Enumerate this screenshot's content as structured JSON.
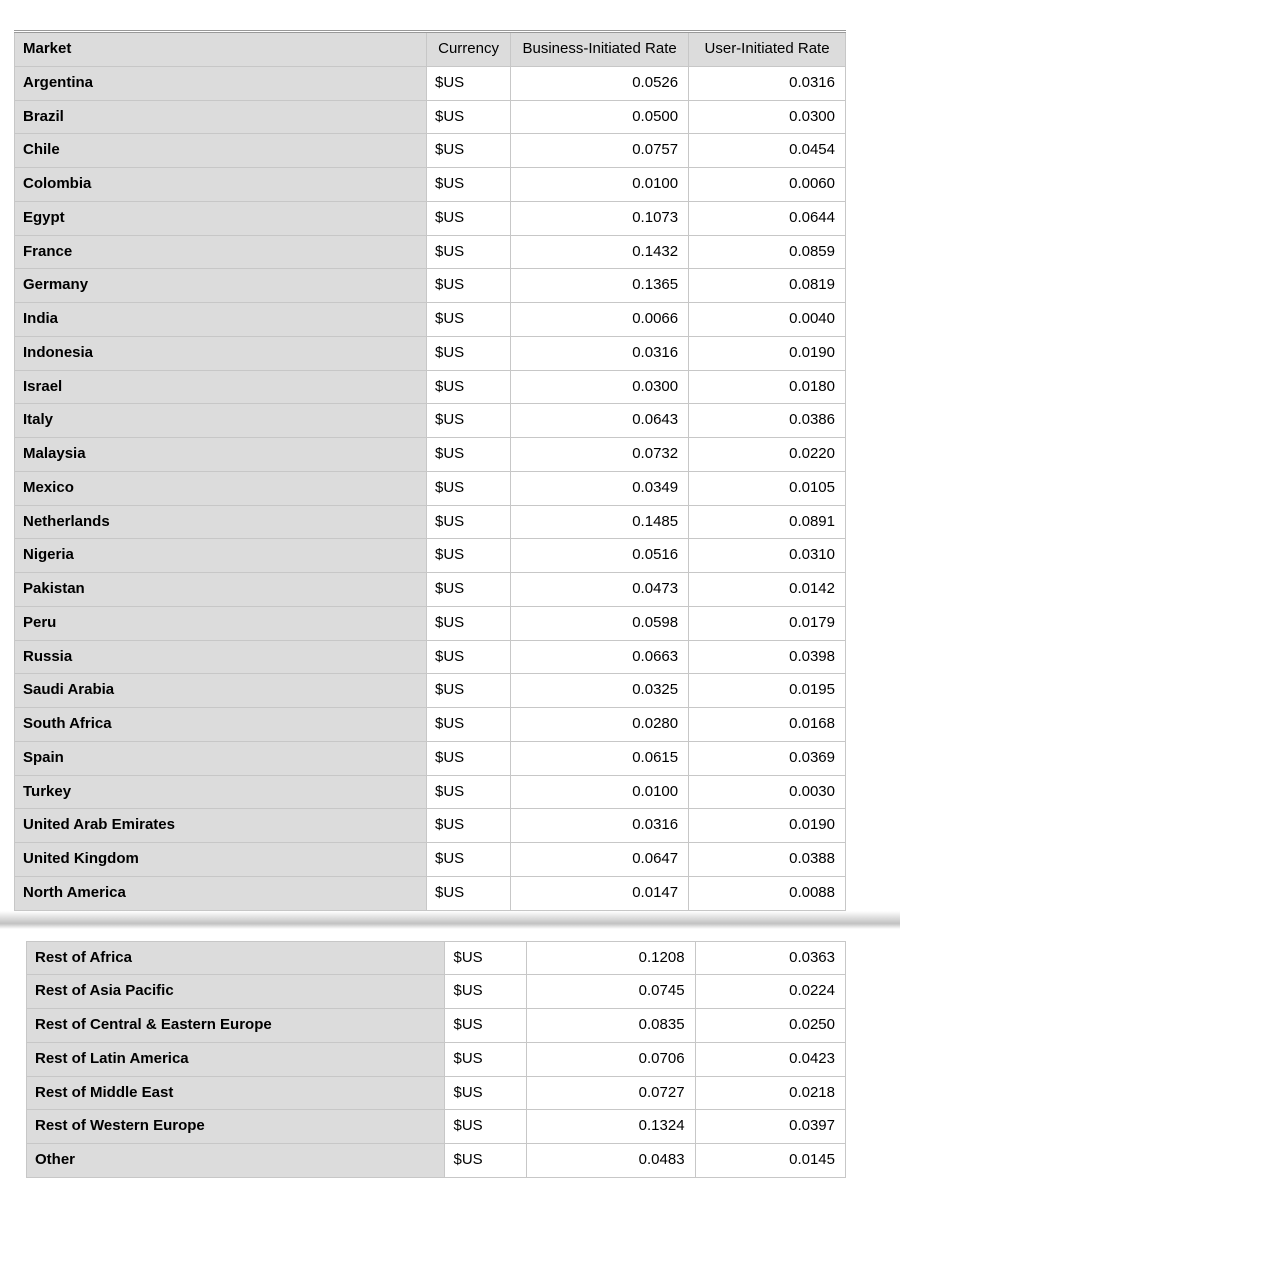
{
  "columns": {
    "market": "Market",
    "currency": "Currency",
    "biz": "Business-Initiated Rate",
    "user": "User-Initiated Rate"
  },
  "currency_label": "$US",
  "rows1": [
    {
      "market": "Argentina",
      "biz": "0.0526",
      "user": "0.0316"
    },
    {
      "market": "Brazil",
      "biz": "0.0500",
      "user": "0.0300"
    },
    {
      "market": "Chile",
      "biz": "0.0757",
      "user": "0.0454"
    },
    {
      "market": "Colombia",
      "biz": "0.0100",
      "user": "0.0060"
    },
    {
      "market": "Egypt",
      "biz": "0.1073",
      "user": "0.0644"
    },
    {
      "market": "France",
      "biz": "0.1432",
      "user": "0.0859"
    },
    {
      "market": "Germany",
      "biz": "0.1365",
      "user": "0.0819"
    },
    {
      "market": "India",
      "biz": "0.0066",
      "user": "0.0040"
    },
    {
      "market": "Indonesia",
      "biz": "0.0316",
      "user": "0.0190"
    },
    {
      "market": "Israel",
      "biz": "0.0300",
      "user": "0.0180"
    },
    {
      "market": "Italy",
      "biz": "0.0643",
      "user": "0.0386"
    },
    {
      "market": "Malaysia",
      "biz": "0.0732",
      "user": "0.0220"
    },
    {
      "market": "Mexico",
      "biz": "0.0349",
      "user": "0.0105"
    },
    {
      "market": "Netherlands",
      "biz": "0.1485",
      "user": "0.0891"
    },
    {
      "market": "Nigeria",
      "biz": "0.0516",
      "user": "0.0310"
    },
    {
      "market": "Pakistan",
      "biz": "0.0473",
      "user": "0.0142"
    },
    {
      "market": "Peru",
      "biz": "0.0598",
      "user": "0.0179"
    },
    {
      "market": "Russia",
      "biz": "0.0663",
      "user": "0.0398"
    },
    {
      "market": "Saudi Arabia",
      "biz": "0.0325",
      "user": "0.0195"
    },
    {
      "market": "South Africa",
      "biz": "0.0280",
      "user": "0.0168"
    },
    {
      "market": "Spain",
      "biz": "0.0615",
      "user": "0.0369"
    },
    {
      "market": "Turkey",
      "biz": "0.0100",
      "user": "0.0030"
    },
    {
      "market": "United Arab Emirates",
      "biz": "0.0316",
      "user": "0.0190"
    },
    {
      "market": "United Kingdom",
      "biz": "0.0647",
      "user": "0.0388"
    },
    {
      "market": "North America",
      "biz": "0.0147",
      "user": "0.0088"
    }
  ],
  "rows2": [
    {
      "market": "Rest of Africa",
      "biz": "0.1208",
      "user": "0.0363"
    },
    {
      "market": "Rest of Asia Pacific",
      "biz": "0.0745",
      "user": "0.0224"
    },
    {
      "market": "Rest of Central & Eastern Europe",
      "biz": "0.0835",
      "user": "0.0250"
    },
    {
      "market": "Rest of Latin America",
      "biz": "0.0706",
      "user": "0.0423"
    },
    {
      "market": "Rest of Middle East",
      "biz": "0.0727",
      "user": "0.0218"
    },
    {
      "market": "Rest of Western Europe",
      "biz": "0.1324",
      "user": "0.0397"
    },
    {
      "market": "Other",
      "biz": "0.0483",
      "user": "0.0145"
    }
  ]
}
